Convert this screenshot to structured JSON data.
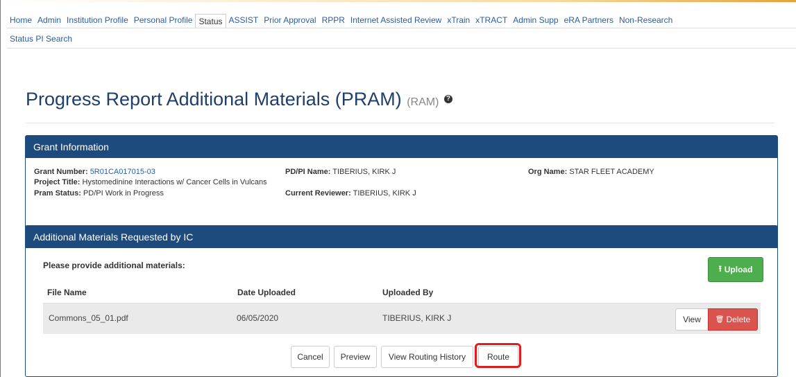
{
  "nav": {
    "items": [
      "Home",
      "Admin",
      "Institution Profile",
      "Personal Profile",
      "Status",
      "ASSIST",
      "Prior Approval",
      "RPPR",
      "Internet Assisted Review",
      "xTrain",
      "xTRACT",
      "Admin Supp",
      "eRA Partners",
      "Non-Research"
    ],
    "active": "Status"
  },
  "subnav": {
    "link": "Status PI Search"
  },
  "page": {
    "title": "Progress Report Additional Materials (PRAM)",
    "abbr": "(RAM)",
    "help": "?"
  },
  "grant_panel": {
    "heading": "Grant Information",
    "grant_number_label": "Grant Number:",
    "grant_number": "5R01CA017015-03",
    "pdpi_label": "PD/PI Name:",
    "pdpi": "TIBERIUS, KIRK J",
    "org_label": "Org Name:",
    "org": "STAR FLEET ACADEMY",
    "title_label": "Project Title:",
    "project_title": "Hystomedinine Interactions w/ Cancer Cells in Vulcans",
    "status_label": "Pram Status:",
    "status": "PD/PI Work in Progress",
    "reviewer_label": "Current Reviewer:",
    "reviewer": "TIBERIUS, KIRK J"
  },
  "materials_panel": {
    "heading": "Additional Materials Requested by IC",
    "request_text": "Please provide additional materials:",
    "upload_label": "Upload",
    "columns": [
      "File Name",
      "Date Uploaded",
      "Uploaded By"
    ],
    "rows": [
      {
        "file": "Commons_05_01.pdf",
        "date": "06/05/2020",
        "by": "TIBERIUS, KIRK J"
      }
    ],
    "view_label": "View",
    "delete_label": "Delete"
  },
  "footer": {
    "cancel": "Cancel",
    "preview": "Preview",
    "routing_history": "View Routing History",
    "route": "Route"
  },
  "colors": {
    "panel_header": "#1d4b7e",
    "upload": "#4cae4c",
    "delete": "#d9534f",
    "highlight": "#e01c1c",
    "link": "#2a5d9f"
  }
}
